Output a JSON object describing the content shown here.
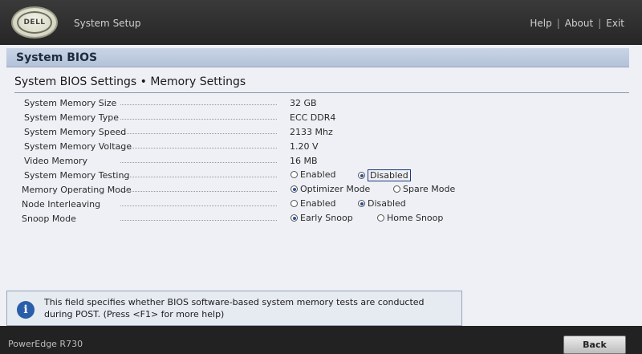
{
  "header": {
    "logo": "DELL",
    "app_title": "System Setup",
    "links": [
      "Help",
      "About",
      "Exit"
    ],
    "separator": "|"
  },
  "section": {
    "title": "System BIOS",
    "page_title": "System BIOS Settings • Memory Settings"
  },
  "settings": [
    {
      "label": "System Memory Size",
      "value": "32 GB"
    },
    {
      "label": "System Memory Type",
      "value": "ECC DDR4"
    },
    {
      "label": "System Memory Speed",
      "value": "2133 Mhz"
    },
    {
      "label": "System Memory Voltage",
      "value": "1.20 V"
    },
    {
      "label": "Video Memory",
      "value": "16 MB"
    },
    {
      "label": "System Memory Testing",
      "options": [
        "Enabled",
        "Disabled"
      ],
      "selected": "Disabled"
    },
    {
      "label": "Memory Operating Mode",
      "options": [
        "Optimizer Mode",
        "Spare Mode"
      ],
      "selected": "Optimizer Mode"
    },
    {
      "label": "Node Interleaving",
      "options": [
        "Enabled",
        "Disabled"
      ],
      "selected": "Disabled"
    },
    {
      "label": "Snoop Mode",
      "options": [
        "Early Snoop",
        "Home Snoop"
      ],
      "selected": "Early Snoop"
    }
  ],
  "help": {
    "icon": "info-icon",
    "text": "This field specifies whether BIOS software-based system memory tests are conducted during POST. (Press <F1> for more help)"
  },
  "footer": {
    "model": "PowerEdge R730",
    "back_label": "Back"
  },
  "colors": {
    "accent": "#2c4f9a",
    "panel_bg": "#eef0f5",
    "header_bg": "#2b2b2b"
  }
}
